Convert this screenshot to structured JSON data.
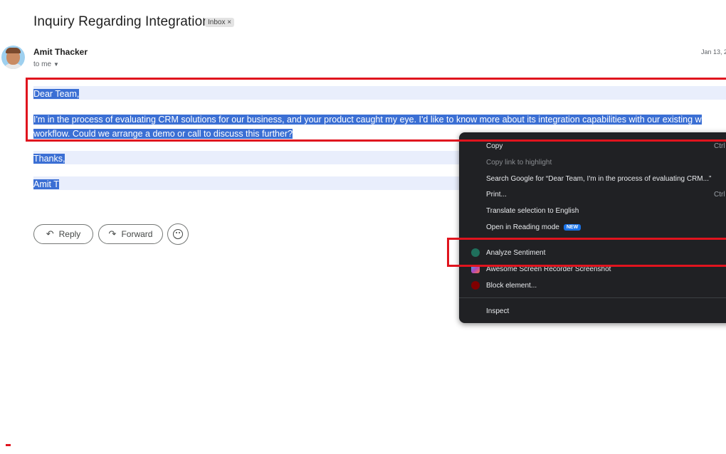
{
  "email": {
    "subject": "Inquiry Regarding Integration",
    "label_chip": "Inbox ×",
    "sender": "Amit Thacker",
    "recipient": "to me",
    "date": "Jan 13, 2",
    "body": {
      "greeting": "Dear Team,",
      "para_line1": "I'm in the process of evaluating CRM solutions for our business, and your product caught my eye. I'd like to know more about its integration capabilities with our existing w",
      "para_line2": "workflow. Could we arrange a demo or call to discuss this further?",
      "closing": "Thanks,",
      "signature": "Amit T"
    }
  },
  "actions": {
    "reply_label": "Reply",
    "forward_label": "Forward",
    "reply_icon": "reply-arrow-icon",
    "forward_icon": "forward-arrow-icon",
    "emoji_icon": "emoji-smile-icon"
  },
  "context_menu": {
    "items": [
      {
        "label": "Copy",
        "shortcut": "Ctrl"
      },
      {
        "label": "Copy link to highlight"
      },
      {
        "label": "Search Google for “Dear Team,  I'm in the process of evaluating CRM...”"
      },
      {
        "label": "Print...",
        "shortcut": "Ctrl"
      },
      {
        "label": "Translate selection to English"
      },
      {
        "label": "Open in Reading mode",
        "badge": "NEW"
      },
      {
        "label": "Analyze Sentiment",
        "icon": "chatgpt-icon"
      },
      {
        "label": "Awesome Screen Recorder  Screenshot",
        "icon": "screen-recorder-icon"
      },
      {
        "label": "Block element...",
        "icon": "ublock-icon"
      },
      {
        "label": "Inspect"
      }
    ]
  },
  "colors": {
    "selection": "#3b6fd4",
    "annotation": "#e0141e",
    "menu_bg": "#202124"
  }
}
